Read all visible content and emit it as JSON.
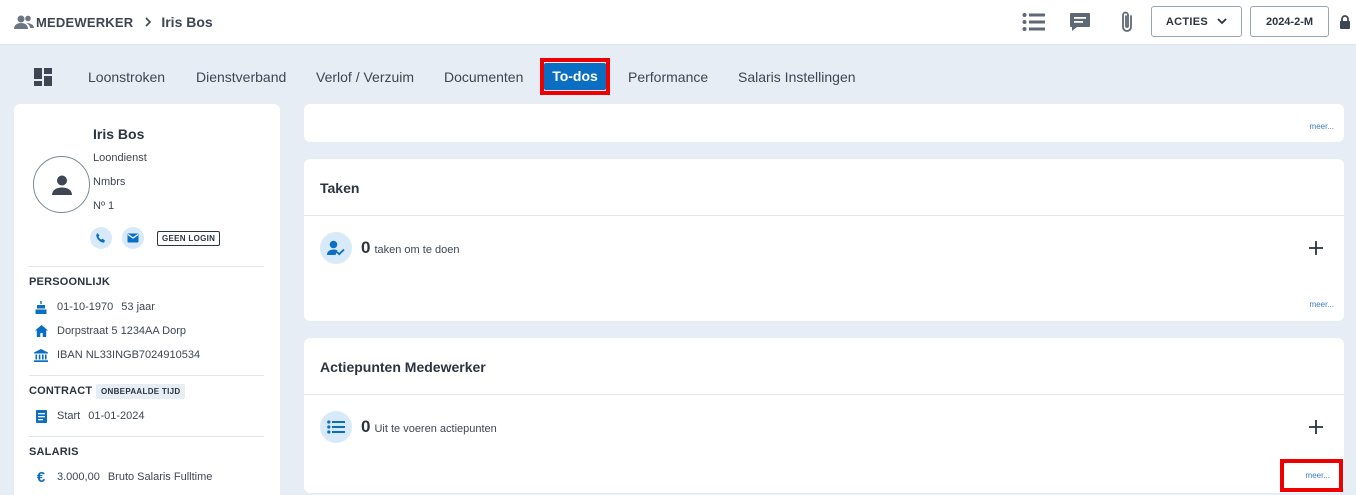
{
  "header": {
    "section": "MEDEWERKER",
    "employee_name": "Iris Bos",
    "actions_label": "ACTIES",
    "period_label": "2024-2-M"
  },
  "tabs": [
    {
      "label": "Loonstroken"
    },
    {
      "label": "Dienstverband"
    },
    {
      "label": "Verlof / Verzuim"
    },
    {
      "label": "Documenten"
    },
    {
      "label": "To-dos",
      "active": true
    },
    {
      "label": "Performance"
    },
    {
      "label": "Salaris Instellingen"
    }
  ],
  "profile": {
    "name": "Iris Bos",
    "department": "Loondienst",
    "company": "Nmbrs",
    "number": "Nº 1",
    "login_badge": "GEEN LOGIN"
  },
  "personal": {
    "heading": "PERSOONLIJK",
    "birthdate": "01-10-1970",
    "age": "53 jaar",
    "address": "Dorpstraat 5 1234AA Dorp",
    "iban": "IBAN NL33INGB7024910534"
  },
  "contract": {
    "heading": "CONTRACT",
    "badge": "ONBEPAALDE TIJD",
    "start_label": "Start",
    "start_date": "01-01-2024"
  },
  "salary": {
    "heading": "SALARIS",
    "amount": "3.000,00",
    "description": "Bruto Salaris Fulltime"
  },
  "cards": {
    "top_more": "meer...",
    "tasks": {
      "title": "Taken",
      "count": "0",
      "label": "taken om te doen",
      "more": "meer..."
    },
    "action_points": {
      "title": "Actiepunten Medewerker",
      "count": "0",
      "label": "Uit te voeren actiepunten",
      "more": "meer..."
    }
  },
  "colors": {
    "accent": "#0a6fc2",
    "highlight": "#ee0000",
    "background": "#e7edf4",
    "icon_bg": "#d8eaf9"
  }
}
